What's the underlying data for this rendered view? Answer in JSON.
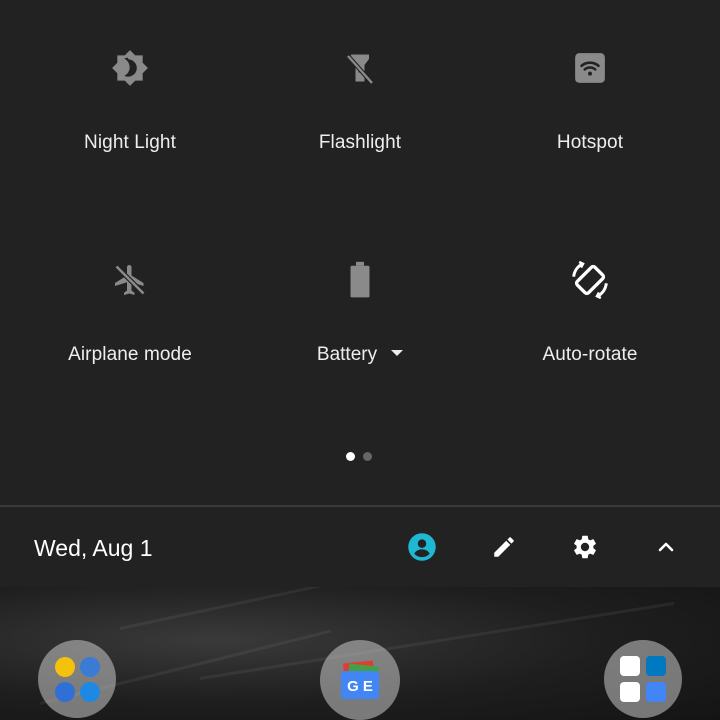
{
  "quick_settings": {
    "tiles": [
      {
        "label": "Night Light",
        "icon": "night-light-icon"
      },
      {
        "label": "Flashlight",
        "icon": "flashlight-icon"
      },
      {
        "label": "Hotspot",
        "icon": "hotspot-icon"
      },
      {
        "label": "Airplane mode",
        "icon": "airplane-icon"
      },
      {
        "label": "Battery",
        "icon": "battery-icon"
      },
      {
        "label": "Auto-rotate",
        "icon": "auto-rotate-icon"
      }
    ],
    "page_indicator": {
      "current_page": 1,
      "total_pages": 2
    }
  },
  "footer": {
    "date": "Wed, Aug 1",
    "buttons": [
      "user-icon",
      "edit-icon",
      "settings-icon",
      "collapse-icon"
    ]
  },
  "home_screen": {
    "folders": [
      "communication-folder",
      "google-news-app",
      "productivity-folder"
    ],
    "news_icon_text": "G E"
  },
  "colors": {
    "panel_bg": "#222222",
    "divider": "#3a3a3a",
    "tile_inactive": "#8a8a8a",
    "tile_active": "#ffffff",
    "accent": "#1fb8d3",
    "text": "#eeeeee"
  }
}
